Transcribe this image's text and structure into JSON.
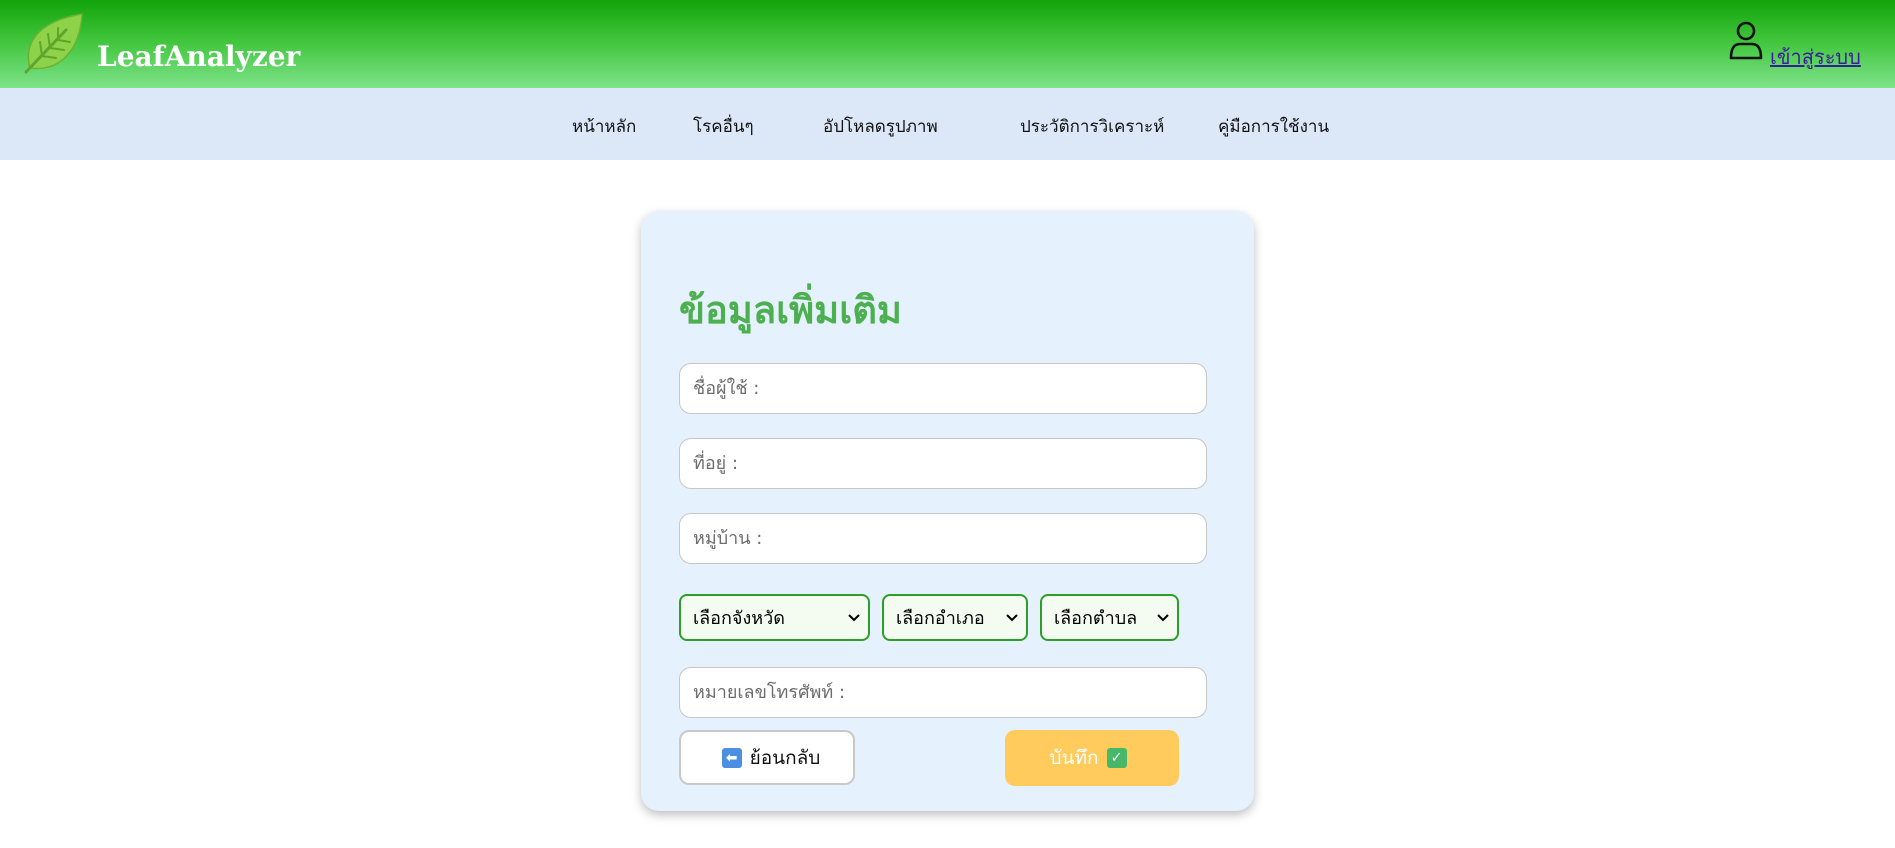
{
  "header": {
    "brand": "LeafAnalyzer",
    "login_label": "เข้าสู่ระบบ",
    "logo_icon": "leaf-icon",
    "user_icon": "user-icon"
  },
  "nav": {
    "items": [
      {
        "label": "หน้าหลัก"
      },
      {
        "label": "โรคอื่นๆ"
      },
      {
        "label": "อัปโหลดรูปภาพ"
      },
      {
        "label": "ประวัติการวิเคราะห์"
      },
      {
        "label": "คู่มือการใช้งาน"
      }
    ]
  },
  "form": {
    "title": "ข้อมูลเพิ่มเติม",
    "username": {
      "placeholder": "ชื่อผู้ใช้ :",
      "value": ""
    },
    "address": {
      "placeholder": "ที่อยู่ :",
      "value": ""
    },
    "village": {
      "placeholder": "หมู่บ้าน :",
      "value": ""
    },
    "province": {
      "selected": "เลือกจังหวัด"
    },
    "district": {
      "selected": "เลือกอำเภอ"
    },
    "subdistrict": {
      "selected": "เลือกตำบล"
    },
    "phone": {
      "placeholder": "หมายเลขโทรศัพท์ :",
      "value": ""
    },
    "back_label": "ย้อนกลับ",
    "back_icon": "left-arrow-icon",
    "save_label": "บันทึก",
    "save_icon": "check-icon"
  },
  "colors": {
    "header_top": "#12a30a",
    "header_bottom": "#7ee38a",
    "nav_bg": "#dce8f8",
    "card_bg": "#e6f1fe",
    "title": "#4caf50",
    "select_border": "#2e9e2a",
    "save_bg": "#ffcb5c"
  }
}
